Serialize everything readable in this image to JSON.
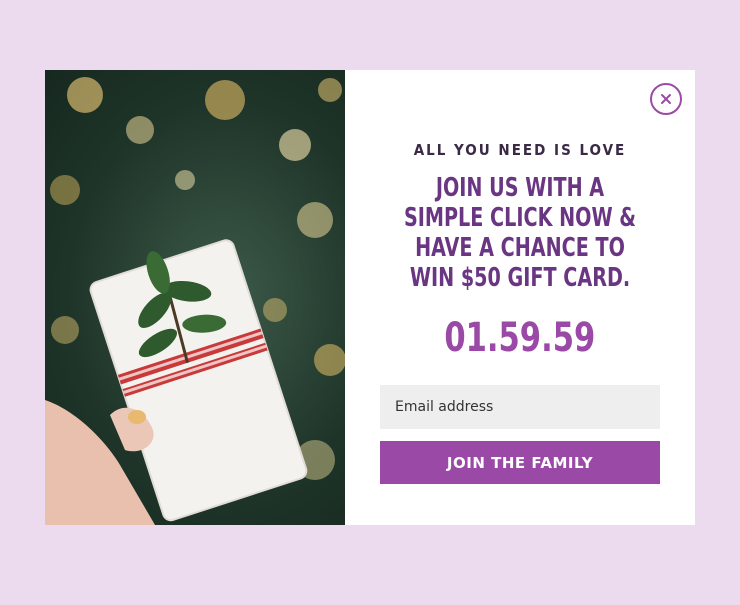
{
  "popup": {
    "kicker": "ALL YOU NEED IS LOVE",
    "headline": "JOIN US WITH A SIMPLE CLICK NOW & HAVE A CHANCE TO WIN $50 GIFT CARD.",
    "timer": "01.59.59",
    "email_placeholder": "Email address",
    "submit_label": "JOIN THE FAMILY",
    "close_icon": "close-icon"
  },
  "colors": {
    "background": "#ecdaee",
    "accent": "#9a49a6",
    "headline": "#6a3582"
  }
}
